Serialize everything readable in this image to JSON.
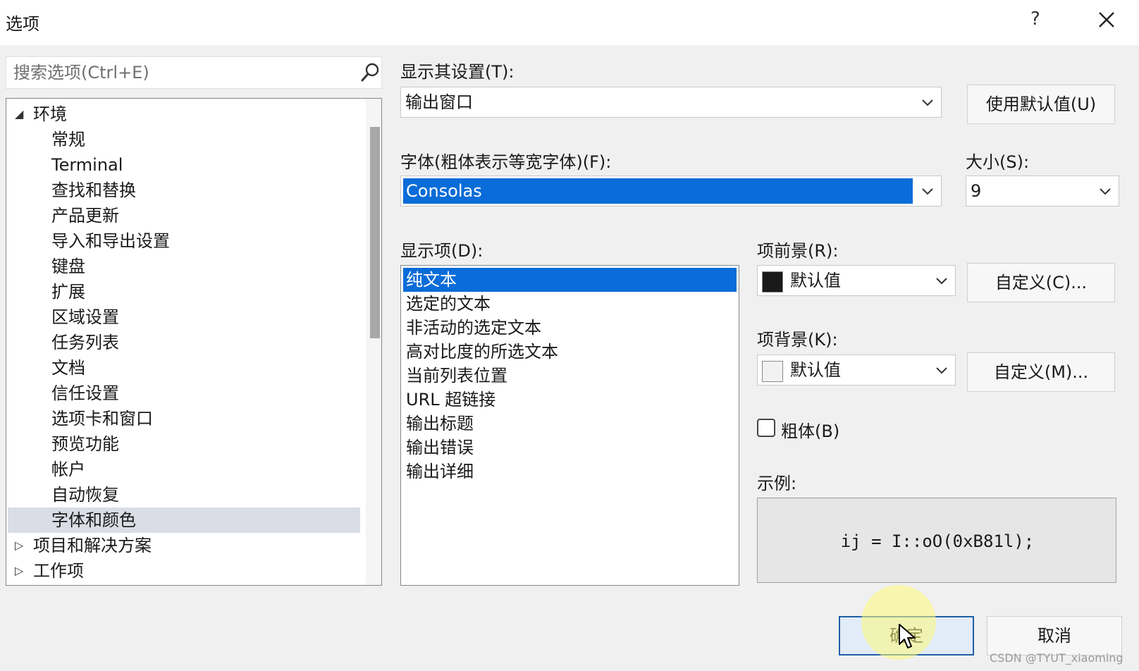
{
  "window": {
    "title": "选项",
    "help_glyph": "?"
  },
  "search": {
    "placeholder": "搜索选项(Ctrl+E)"
  },
  "tree": {
    "root_environment": "环境",
    "children": [
      "常规",
      "Terminal",
      "查找和替换",
      "产品更新",
      "导入和导出设置",
      "键盘",
      "扩展",
      "区域设置",
      "任务列表",
      "文档",
      "信任设置",
      "选项卡和窗口",
      "预览功能",
      "帐户",
      "自动恢复",
      "字体和颜色"
    ],
    "selected": "字体和颜色",
    "root_projects": "项目和解决方案",
    "root_workitems": "工作项"
  },
  "settings": {
    "show_settings_label": "显示其设置(T):",
    "show_settings_value": "输出窗口",
    "use_defaults_button": "使用默认值(U)",
    "font_label": "字体(粗体表示等宽字体)(F):",
    "font_value": "Consolas",
    "size_label": "大小(S):",
    "size_value": "9",
    "display_items_label": "显示项(D):",
    "display_items": [
      "纯文本",
      "选定的文本",
      "非活动的选定文本",
      "高对比度的所选文本",
      "当前列表位置",
      "URL 超链接",
      "输出标题",
      "输出错误",
      "输出详细"
    ],
    "display_items_selected": "纯文本",
    "foreground_label": "项前景(R):",
    "foreground_value": "默认值",
    "foreground_swatch": "#1a1a1a",
    "foreground_custom_button": "自定义(C)...",
    "background_label": "项背景(K):",
    "background_value": "默认值",
    "background_swatch": "#f2f2f2",
    "background_custom_button": "自定义(M)...",
    "bold_label": "粗体(B)",
    "bold_checked": false,
    "sample_label": "示例:",
    "sample_text": "ij = I::oO(0xB81l);"
  },
  "footer": {
    "ok_button": "确定",
    "cancel_button": "取消"
  },
  "watermark": "CSDN @TYUT_xiaoming",
  "colors": {
    "selection": "#0a6cd8",
    "tree_selected": "#dadde6",
    "ok_border": "#1f5fa8"
  }
}
